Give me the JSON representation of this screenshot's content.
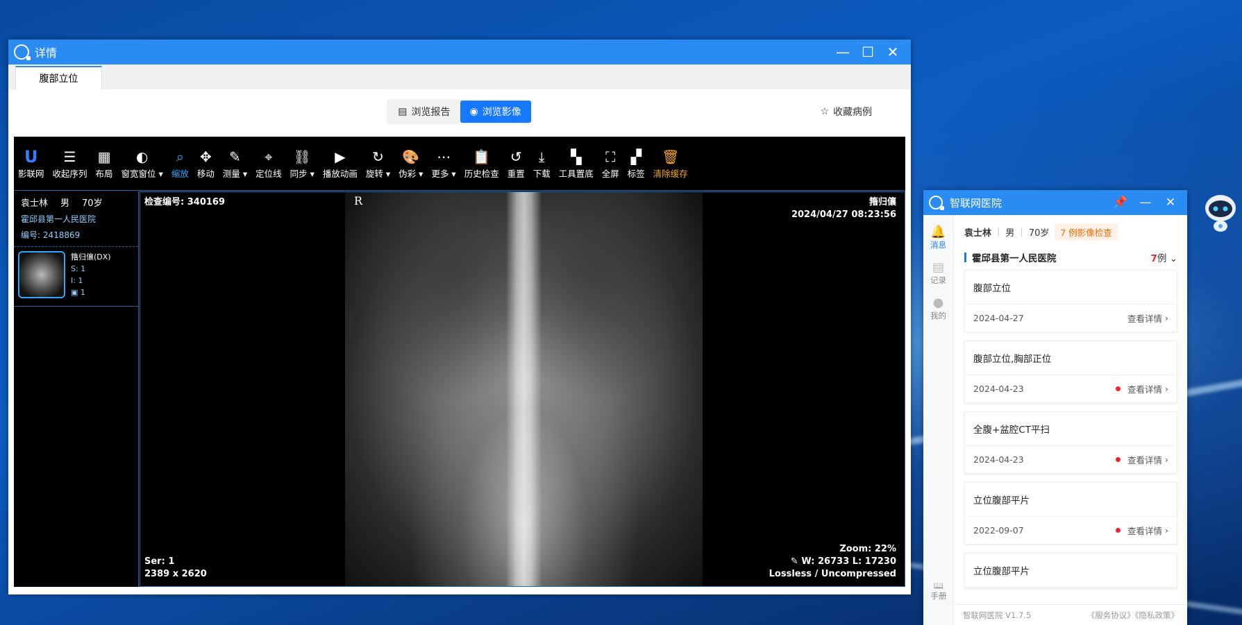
{
  "main_window": {
    "title": "详情",
    "tab": "腹部立位",
    "view_report": "浏览报告",
    "view_image": "浏览影像",
    "favorite": "收藏病例"
  },
  "toolbar": [
    {
      "icon": "brand-logo-icon",
      "label": "影联网",
      "name": "yinglianwang"
    },
    {
      "icon": "collapse-list-icon",
      "label": "收起序列",
      "name": "collapse-series"
    },
    {
      "icon": "grid-icon",
      "label": "布局",
      "name": "layout"
    },
    {
      "icon": "contrast-icon",
      "label": "窗宽窗位",
      "name": "window-level",
      "dropdown": true
    },
    {
      "icon": "magnifier-icon",
      "label": "缩放",
      "name": "zoom",
      "active": true
    },
    {
      "icon": "move-icon",
      "label": "移动",
      "name": "move"
    },
    {
      "icon": "ruler-icon",
      "label": "测量",
      "name": "measure",
      "dropdown": true
    },
    {
      "icon": "locator-icon",
      "label": "定位线",
      "name": "locator-line"
    },
    {
      "icon": "link-icon",
      "label": "同步",
      "name": "sync",
      "dropdown": true
    },
    {
      "icon": "play-icon",
      "label": "播放动画",
      "name": "play-animation"
    },
    {
      "icon": "rotate-icon",
      "label": "旋转",
      "name": "rotate",
      "dropdown": true
    },
    {
      "icon": "palette-icon",
      "label": "伪彩",
      "name": "pseudo-color",
      "dropdown": true
    },
    {
      "icon": "more-icon",
      "label": "更多",
      "name": "more",
      "dropdown": true
    },
    {
      "icon": "clipboard-icon",
      "label": "历史检查",
      "name": "history-exam"
    },
    {
      "icon": "reset-icon",
      "label": "重置",
      "name": "reset"
    },
    {
      "icon": "download-icon",
      "label": "下载",
      "name": "download"
    },
    {
      "icon": "toolbar-bottom-icon",
      "label": "工具置底",
      "name": "tools-bottom"
    },
    {
      "icon": "fullscreen-icon",
      "label": "全屏",
      "name": "fullscreen"
    },
    {
      "icon": "tag-icon",
      "label": "标签",
      "name": "tags"
    },
    {
      "icon": "basket-icon",
      "label": "清除缓存",
      "name": "clear-cache",
      "warn": true
    }
  ],
  "patient": {
    "name": "袁士林",
    "sex": "男",
    "age": "70岁",
    "hospital": "霍邱县第一人民医院",
    "id_label": "编号: 2418869"
  },
  "series": {
    "name": "簎归儴(DX)",
    "s": "S: 1",
    "i": "I: 1",
    "count": "1"
  },
  "overlay": {
    "exam_no": "检查编号: 340169",
    "orientation": "R",
    "top_right_name": "簎归儴",
    "datetime": "2024/04/27 08:23:56",
    "ser": "Ser: 1",
    "dims": "2389 x 2620",
    "zoom": "Zoom: 22%",
    "wl": "W: 26733 L: 17230",
    "compression": "Lossless / Uncompressed"
  },
  "panel": {
    "title": "智联网医院",
    "rail": [
      {
        "icon": "bell-icon",
        "label": "消息",
        "active": true
      },
      {
        "icon": "document-icon",
        "label": "记录",
        "active": false
      },
      {
        "icon": "user-icon",
        "label": "我的",
        "active": false
      }
    ],
    "rail_bottom": "手册",
    "patient_name": "袁士林",
    "patient_sex": "男",
    "patient_age": "70岁",
    "exam_badge": "7 例影像检查",
    "hospital": "霍邱县第一人民医院",
    "hospital_count": "7",
    "hospital_count_unit": "例",
    "detail_label": "查看详情",
    "records": [
      {
        "title": "腹部立位",
        "date": "2024-04-27",
        "unread": false
      },
      {
        "title": "腹部立位,胸部正位",
        "date": "2024-04-23",
        "unread": true
      },
      {
        "title": "全腹+盆腔CT平扫",
        "date": "2024-04-23",
        "unread": true
      },
      {
        "title": "立位腹部平片",
        "date": "2022-09-07",
        "unread": true
      },
      {
        "title": "立位腹部平片",
        "date": "",
        "unread": false
      }
    ],
    "version": "智联网医院 V1.7.5",
    "links": "《服务协议》《隐私政策》"
  }
}
